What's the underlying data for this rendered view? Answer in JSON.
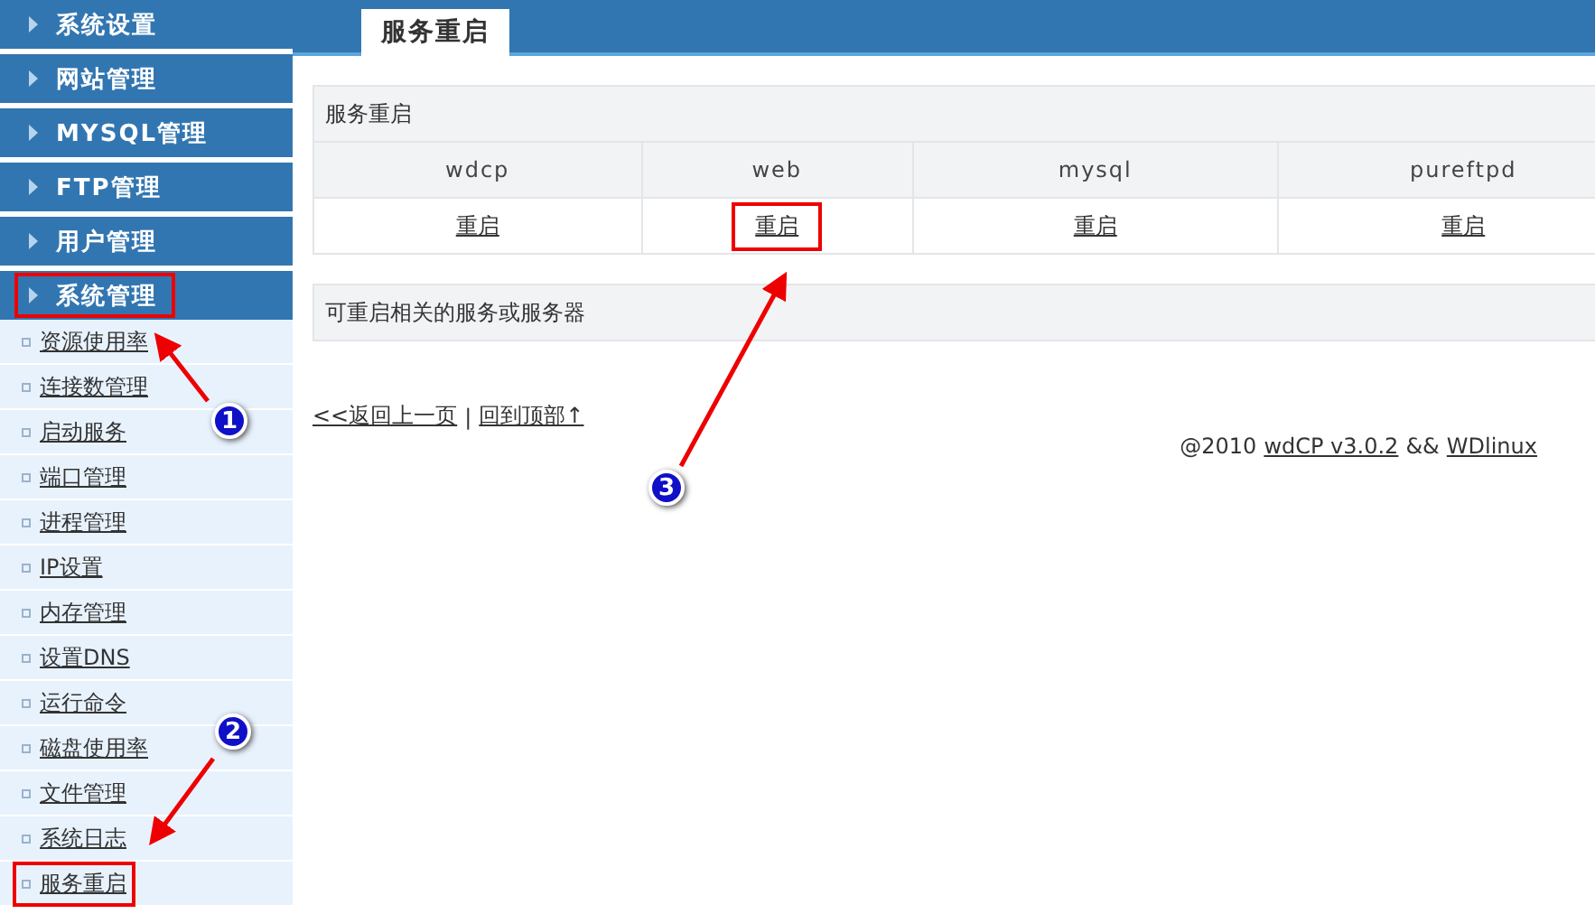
{
  "sidebar": {
    "sections": [
      {
        "label": "系统设置",
        "highlighted": false
      },
      {
        "label": "网站管理",
        "highlighted": false
      },
      {
        "label": "MYSQL管理",
        "highlighted": false
      },
      {
        "label": "FTP管理",
        "highlighted": false
      },
      {
        "label": "用户管理",
        "highlighted": false
      },
      {
        "label": "系统管理",
        "highlighted": true,
        "items": [
          {
            "label": "资源使用率",
            "highlighted": false
          },
          {
            "label": "连接数管理",
            "highlighted": false
          },
          {
            "label": "启动服务",
            "highlighted": false
          },
          {
            "label": "端口管理",
            "highlighted": false
          },
          {
            "label": "进程管理",
            "highlighted": false
          },
          {
            "label": "IP设置",
            "highlighted": false
          },
          {
            "label": "内存管理",
            "highlighted": false
          },
          {
            "label": "设置DNS",
            "highlighted": false
          },
          {
            "label": "运行命令",
            "highlighted": false
          },
          {
            "label": "磁盘使用率",
            "highlighted": false
          },
          {
            "label": "文件管理",
            "highlighted": false
          },
          {
            "label": "系统日志",
            "highlighted": false
          },
          {
            "label": "服务重启",
            "highlighted": true
          }
        ]
      }
    ]
  },
  "tabs": [
    {
      "label": "服务重启",
      "selected": true
    }
  ],
  "panel": {
    "title": "服务重启",
    "columns": [
      "wdcp",
      "web",
      "mysql",
      "pureftpd"
    ],
    "actions": [
      {
        "label": "重启",
        "highlighted": false
      },
      {
        "label": "重启",
        "highlighted": true
      },
      {
        "label": "重启",
        "highlighted": false
      },
      {
        "label": "重启",
        "highlighted": false
      }
    ]
  },
  "note": "可重启相关的服务或服务器",
  "links": {
    "back": "<<返回上一页",
    "separator": "|",
    "top": "回到顶部↑"
  },
  "footer": {
    "prefix": "@2010",
    "product": "wdCP v3.0.2",
    "joiner": "&&",
    "vendor": "WDlinux"
  },
  "callouts": [
    "1",
    "2",
    "3"
  ]
}
